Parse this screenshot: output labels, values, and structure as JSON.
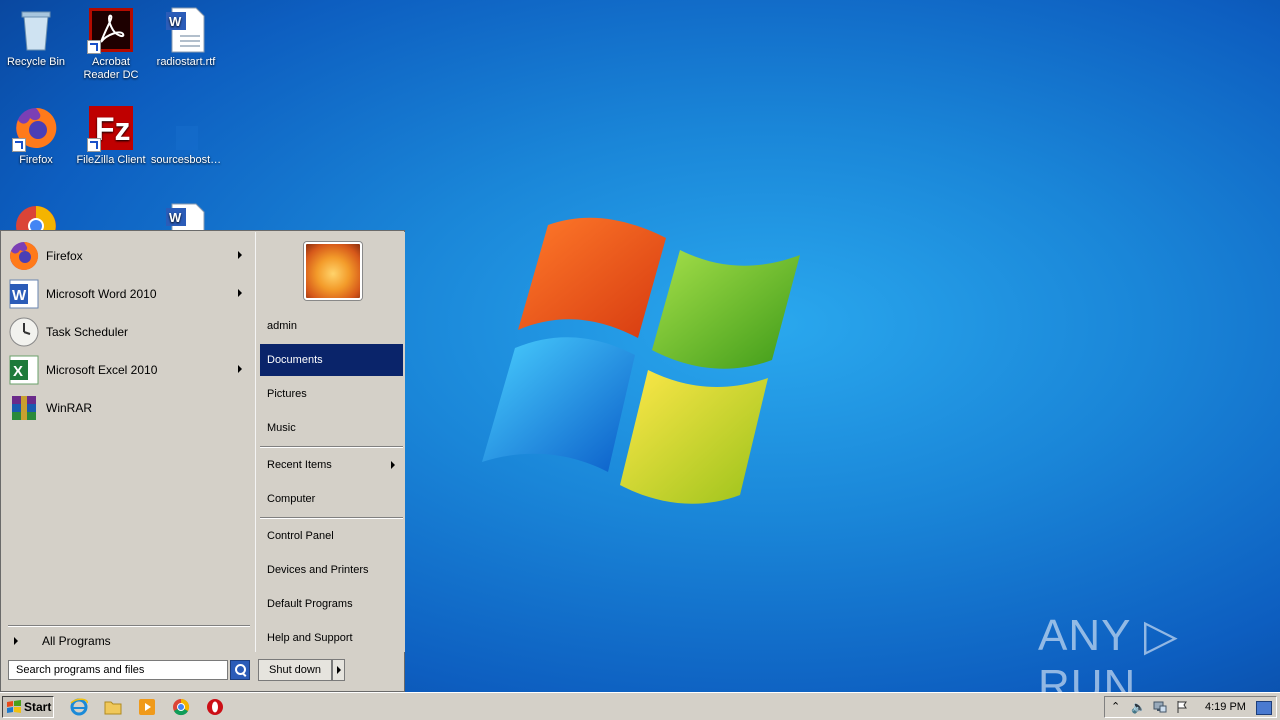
{
  "desktop": {
    "icons": [
      {
        "label": "Recycle Bin",
        "icon": "recycle-bin-icon"
      },
      {
        "label": "Acrobat Reader DC",
        "icon": "acrobat-icon"
      },
      {
        "label": "radiostart.rtf",
        "icon": "word-document-icon"
      },
      {
        "label": "Firefox",
        "icon": "firefox-icon"
      },
      {
        "label": "FileZilla Client",
        "icon": "filezilla-icon"
      },
      {
        "label": "sourcesbost…",
        "icon": "file-icon"
      }
    ],
    "watermark": "ANY ▷ RUN"
  },
  "start_menu": {
    "programs": [
      {
        "label": "Firefox",
        "icon": "firefox-icon",
        "has_submenu": true
      },
      {
        "label": "Microsoft Word 2010",
        "icon": "word-icon",
        "has_submenu": true
      },
      {
        "label": "Task Scheduler",
        "icon": "clock-icon",
        "has_submenu": false
      },
      {
        "label": "Microsoft Excel 2010",
        "icon": "excel-icon",
        "has_submenu": true
      },
      {
        "label": "WinRAR",
        "icon": "winrar-icon",
        "has_submenu": false
      }
    ],
    "all_programs": "All Programs",
    "search_placeholder": "Search programs and files",
    "right": {
      "user": "admin",
      "documents": "Documents",
      "pictures": "Pictures",
      "music": "Music",
      "recent_items": "Recent Items",
      "computer": "Computer",
      "control_panel": "Control Panel",
      "devices_printers": "Devices and Printers",
      "default_programs": "Default Programs",
      "help_support": "Help and Support"
    },
    "shutdown": "Shut down"
  },
  "taskbar": {
    "start_label": "Start",
    "pinned": [
      "internet-explorer-icon",
      "folder-icon",
      "media-player-icon",
      "chrome-icon",
      "opera-icon"
    ],
    "clock": "4:19 PM"
  },
  "colors": {
    "selection": "#0a246a",
    "desktop": "#1a86d8"
  }
}
